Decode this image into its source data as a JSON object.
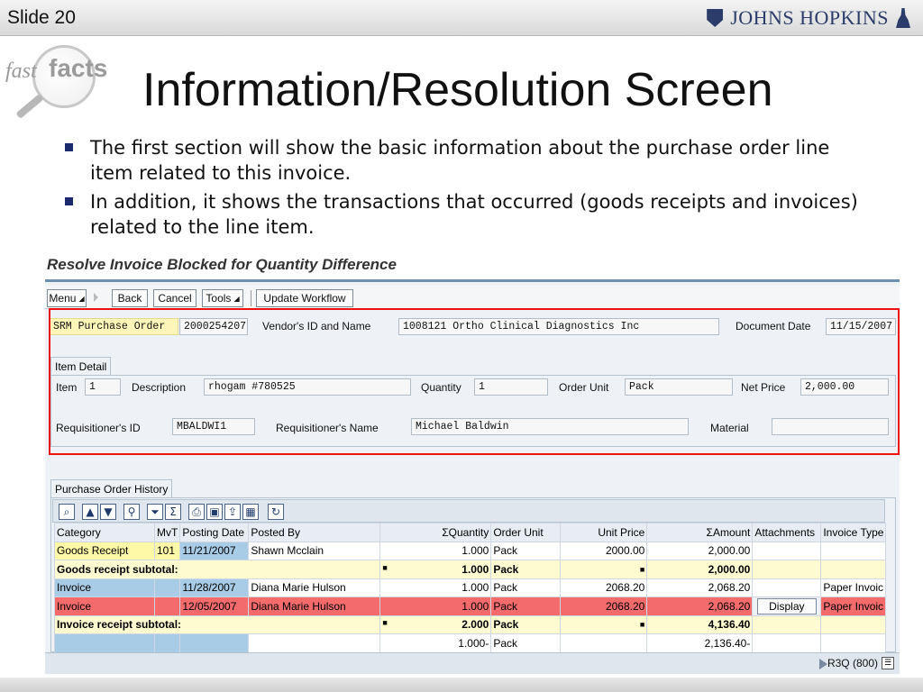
{
  "slide": {
    "number_label": "Slide 20",
    "logo_text": "JOHNS HOPKINS",
    "fastfacts_fast": "fast",
    "fastfacts_facts": "facts",
    "title": "Information/Resolution Screen",
    "bullets": [
      "The first section will show the basic information about the purchase order line item related to this invoice.",
      "In addition, it shows the transactions that occurred (goods receipts and invoices) related to the line item."
    ]
  },
  "sap": {
    "screen_title": "Resolve Invoice Blocked for Quantity Difference",
    "toolbar": {
      "menu": "Menu",
      "back": "Back",
      "cancel": "Cancel",
      "tools": "Tools",
      "update_workflow": "Update Workflow"
    },
    "header": {
      "po_label": "SRM Purchase Order",
      "po_value": "2000254207",
      "vendor_label": "Vendor's ID and Name",
      "vendor_value": "1008121 Ortho Clinical Diagnostics Inc",
      "docdate_label": "Document Date",
      "docdate_value": "11/15/2007"
    },
    "item_detail": {
      "tab": "Item Detail",
      "item_label": "Item",
      "item_value": "1",
      "desc_label": "Description",
      "desc_value": "rhogam #780525",
      "qty_label": "Quantity",
      "qty_value": "1",
      "unit_label": "Order Unit",
      "unit_value": "Pack",
      "price_label": "Net Price",
      "price_value": "2,000.00",
      "req_id_label": "Requisitioner's ID",
      "req_id_value": "MBALDWI1",
      "req_name_label": "Requisitioner's Name",
      "req_name_value": "Michael Baldwin",
      "material_label": "Material",
      "material_value": ""
    },
    "history": {
      "tab": "Purchase Order History",
      "columns": [
        "Category",
        "MvT",
        "Posting Date",
        "Posted By",
        "ΣQuantity",
        "Order Unit",
        "Unit Price",
        "ΣAmount",
        "Attachments",
        "Invoice Type"
      ],
      "rows": [
        [
          "Goods Receipt",
          "101",
          "11/21/2007",
          "Shawn Mcclain",
          "1.000",
          "Pack",
          "2000.00",
          "2,000.00",
          "",
          ""
        ],
        [
          "Goods receipt subtotal:",
          "",
          "",
          "",
          "1.000",
          "Pack",
          "",
          "2,000.00",
          "",
          ""
        ],
        [
          "Invoice",
          "",
          "11/28/2007",
          "Diana Marie Hulson",
          "1.000",
          "Pack",
          "2068.20",
          "2,068.20",
          "",
          "Paper Invoic"
        ],
        [
          "Invoice",
          "",
          "12/05/2007",
          "Diana Marie Hulson",
          "1.000",
          "Pack",
          "2068.20",
          "2,068.20",
          "Display",
          "Paper Invoic"
        ],
        [
          "Invoice receipt subtotal:",
          "",
          "",
          "",
          "2.000",
          "Pack",
          "",
          "4,136.40",
          "",
          ""
        ],
        [
          "",
          "",
          "",
          "",
          "1.000-",
          "Pack",
          "",
          "2,136.40-",
          "",
          ""
        ]
      ]
    },
    "status": {
      "system": "R3Q (800)"
    },
    "colors": {
      "highlight_border": "#e11111",
      "blocked_row": "#f46b6b",
      "subtotal_row": "#fefbd0",
      "category_cell": "#a8cbe6"
    }
  }
}
